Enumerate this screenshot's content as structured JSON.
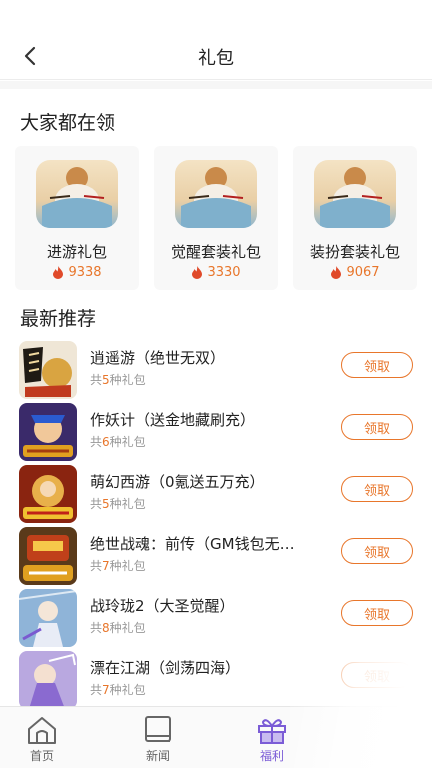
{
  "header": {
    "title": "礼包",
    "back_icon": "chevron-left-icon"
  },
  "hot_section": {
    "title": "大家都在领",
    "cards": [
      {
        "name": "进游礼包",
        "count": "9338",
        "icon": "flame-icon"
      },
      {
        "name": "觉醒套装礼包",
        "count": "3330",
        "icon": "flame-icon"
      },
      {
        "name": "装扮套装礼包",
        "count": "9067",
        "icon": "flame-icon"
      }
    ]
  },
  "recommend_section": {
    "title": "最新推荐",
    "items": [
      {
        "name": "逍遥游（绝世无双）",
        "sub_prefix": "共",
        "sub_num": "5",
        "sub_suffix": "种礼包",
        "button": "领取"
      },
      {
        "name": "作妖计（送金地藏刷充）",
        "sub_prefix": "共",
        "sub_num": "6",
        "sub_suffix": "种礼包",
        "button": "领取"
      },
      {
        "name": "萌幻西游（0氪送五万充）",
        "sub_prefix": "共",
        "sub_num": "5",
        "sub_suffix": "种礼包",
        "button": "领取"
      },
      {
        "name": "绝世战魂：前传（GM钱包无…",
        "sub_prefix": "共",
        "sub_num": "7",
        "sub_suffix": "种礼包",
        "button": "领取"
      },
      {
        "name": "战玲珑2（大圣觉醒）",
        "sub_prefix": "共",
        "sub_num": "8",
        "sub_suffix": "种礼包",
        "button": "领取"
      },
      {
        "name": "漂在江湖（剑荡四海）",
        "sub_prefix": "共",
        "sub_num": "7",
        "sub_suffix": "种礼包",
        "button": "领取"
      }
    ]
  },
  "tabbar": {
    "tabs": [
      {
        "label": "首页",
        "icon": "home-icon"
      },
      {
        "label": "新闻",
        "icon": "book-icon"
      },
      {
        "label": "福利",
        "icon": "gift-icon",
        "active": true
      }
    ]
  },
  "colors": {
    "accent": "#e8762b",
    "active_tab": "#7b5cd6"
  }
}
